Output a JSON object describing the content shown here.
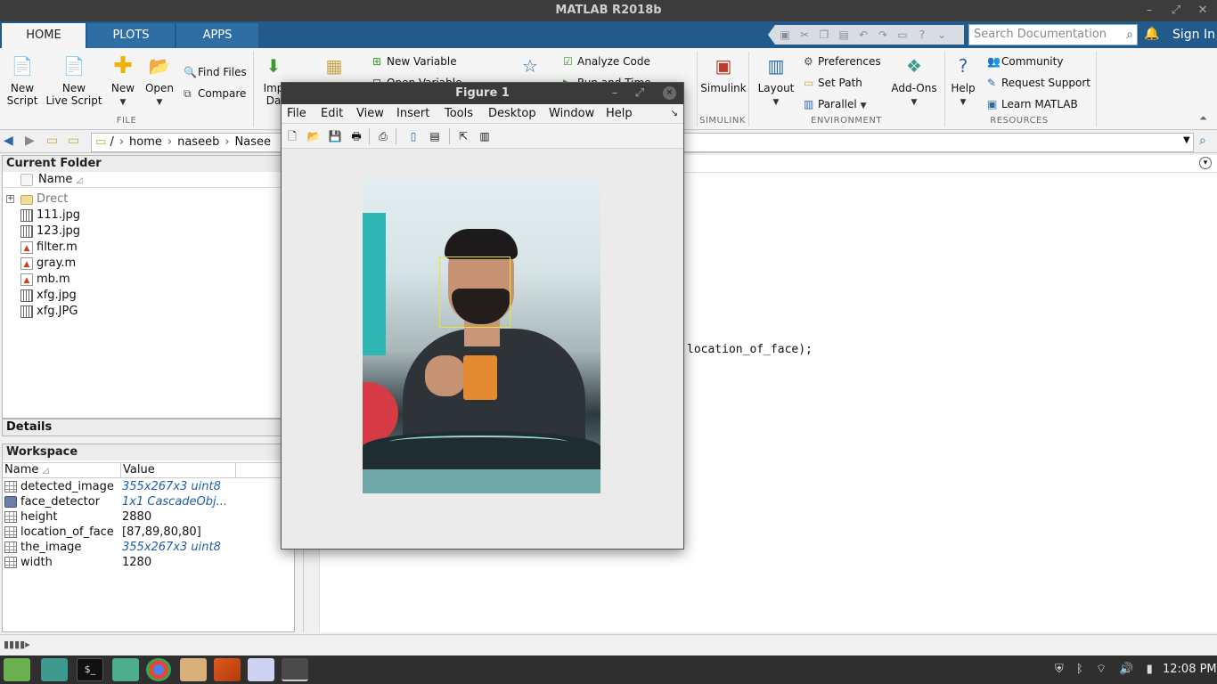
{
  "window": {
    "title": "MATLAB R2018b"
  },
  "tabs": [
    {
      "label": "HOME",
      "active": true
    },
    {
      "label": "PLOTS",
      "active": false
    },
    {
      "label": "APPS",
      "active": false
    }
  ],
  "search": {
    "placeholder": "Search Documentation"
  },
  "account": {
    "signin": "Sign In"
  },
  "ribbon": {
    "file": {
      "new_script": [
        "New",
        "Script"
      ],
      "new_live_script": [
        "New",
        "Live Script"
      ],
      "new": "New",
      "open": "Open",
      "find_files": "Find Files",
      "compare": "Compare",
      "section": "FILE"
    },
    "variable": {
      "import_data": [
        "Imp",
        "Da"
      ],
      "new_variable": "New Variable",
      "open_variable": "Open Variable"
    },
    "code": {
      "analyze_code": "Analyze Code",
      "run_and_time": "Run and Time"
    },
    "simulink": {
      "button": "Simulink",
      "section": "SIMULINK"
    },
    "environment": {
      "layout": "Layout",
      "preferences": "Preferences",
      "set_path": "Set Path",
      "parallel": "Parallel",
      "add_ons": "Add-Ons",
      "section": "ENVIRONMENT"
    },
    "resources": {
      "help": "Help",
      "community": "Community",
      "request_support": "Request Support",
      "learn_matlab": "Learn MATLAB",
      "section": "RESOURCES"
    }
  },
  "address": {
    "segments": [
      "/",
      "home",
      "naseeb",
      "Nasee"
    ]
  },
  "current_folder": {
    "title": "Current Folder",
    "header": "Name",
    "items": [
      {
        "name": "Drect",
        "type": "folder"
      },
      {
        "name": "111.jpg",
        "type": "img"
      },
      {
        "name": "123.jpg",
        "type": "img"
      },
      {
        "name": "filter.m",
        "type": "mfile"
      },
      {
        "name": "gray.m",
        "type": "mfile"
      },
      {
        "name": "mb.m",
        "type": "mfile"
      },
      {
        "name": "xfg.jpg",
        "type": "img"
      },
      {
        "name": "xfg.JPG",
        "type": "img"
      }
    ]
  },
  "details": {
    "title": "Details"
  },
  "workspace": {
    "title": "Workspace",
    "col_name": "Name",
    "col_value": "Value",
    "vars": [
      {
        "name": "detected_image",
        "value": "355x267x3 uint8",
        "italic": true
      },
      {
        "name": "face_detector",
        "value": "1x1 CascadeObj...",
        "italic": true,
        "obj": true
      },
      {
        "name": "height",
        "value": "2880",
        "italic": false
      },
      {
        "name": "location_of_face",
        "value": "[87,89,80,80]",
        "italic": false
      },
      {
        "name": "the_image",
        "value": "355x267x3 uint8",
        "italic": true
      },
      {
        "name": "width",
        "value": "1280",
        "italic": false
      }
    ]
  },
  "command": {
    "visible_line": "location_of_face);"
  },
  "figure": {
    "title": "Figure 1",
    "menu": [
      "File",
      "Edit",
      "View",
      "Insert",
      "Tools",
      "Desktop",
      "Window",
      "Help"
    ],
    "detection_box": [
      87,
      89,
      80,
      80
    ],
    "box_color": "#e6e62a"
  },
  "taskbar": {
    "clock": "12:08 PM"
  },
  "colors": {
    "tab_strip": "#235a8c",
    "accent": "#2f6da5"
  }
}
